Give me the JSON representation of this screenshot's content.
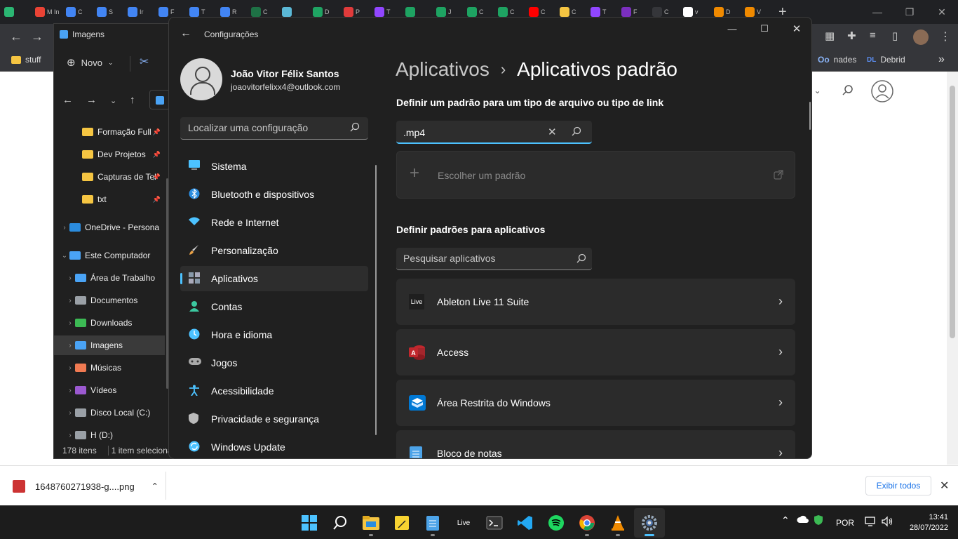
{
  "browser": {
    "tabs": [
      {
        "text": "",
        "color": "#2bb673"
      },
      {
        "text": "M In",
        "color": "#ea4335"
      },
      {
        "text": "C",
        "color": "#4285f4"
      },
      {
        "text": "S",
        "color": "#4285f4"
      },
      {
        "text": "Ir",
        "color": "#4285f4"
      },
      {
        "text": "F",
        "color": "#4285f4"
      },
      {
        "text": "T",
        "color": "#4285f4"
      },
      {
        "text": "R",
        "color": "#4285f4"
      },
      {
        "text": "C",
        "color": "#1e7145"
      },
      {
        "text": "",
        "color": "#5bb8d6"
      },
      {
        "text": "D",
        "color": "#1fa463"
      },
      {
        "text": "P",
        "color": "#e03b3b"
      },
      {
        "text": "T",
        "color": "#9146ff"
      },
      {
        "text": "",
        "color": "#1ea362"
      },
      {
        "text": "J",
        "color": "#1ea362"
      },
      {
        "text": "C",
        "color": "#1ea362"
      },
      {
        "text": "C",
        "color": "#1ea362"
      },
      {
        "text": "C",
        "color": "#ff0000"
      },
      {
        "text": "C",
        "color": "#f5c542"
      },
      {
        "text": "T",
        "color": "#9146ff"
      },
      {
        "text": "F",
        "color": "#7b2fbf"
      },
      {
        "text": "C",
        "color": "#35363a"
      },
      {
        "text": "v",
        "color": "#ffffff"
      },
      {
        "text": "D",
        "color": "#f08a00"
      },
      {
        "text": "V",
        "color": "#f08a00"
      }
    ],
    "bookmarks": [
      "stuff",
      "nades",
      "Debrid"
    ],
    "download_file": "1648760271938-g....png",
    "show_all": "Exibir todos"
  },
  "explorer": {
    "title": "Imagens",
    "new_label": "Novo",
    "tree": [
      {
        "label": "Formação Full",
        "pinned": true,
        "color": "#f5c542"
      },
      {
        "label": "Dev Projetos",
        "pinned": true,
        "color": "#f5c542"
      },
      {
        "label": "Capturas de Tel",
        "pinned": true,
        "color": "#f5c542"
      },
      {
        "label": "txt",
        "pinned": true,
        "color": "#f5c542"
      },
      {
        "label": "OneDrive - Persona",
        "pinned": false,
        "color": "#2b8cde"
      },
      {
        "label": "Este Computador",
        "pinned": false,
        "color": "#4aa3f5"
      },
      {
        "label": "Área de Trabalho",
        "pinned": false,
        "color": "#4aa3f5"
      },
      {
        "label": "Documentos",
        "pinned": false,
        "color": "#9aa0a6"
      },
      {
        "label": "Downloads",
        "pinned": false,
        "color": "#3cba54"
      },
      {
        "label": "Imagens",
        "pinned": false,
        "color": "#4aa3f5"
      },
      {
        "label": "Músicas",
        "pinned": false,
        "color": "#f07a52"
      },
      {
        "label": "Vídeos",
        "pinned": false,
        "color": "#9b59d0"
      },
      {
        "label": "Disco Local (C:)",
        "pinned": false,
        "color": "#9aa0a6"
      },
      {
        "label": "H (D:)",
        "pinned": false,
        "color": "#9aa0a6"
      }
    ],
    "status_count": "178 itens",
    "status_selected": "1 item seleciona"
  },
  "settings": {
    "app_title": "Configurações",
    "profile": {
      "name": "João Vitor Félix Santos",
      "email": "joaovitorfelixx4@outlook.com"
    },
    "search_placeholder": "Localizar uma configuração",
    "nav": [
      {
        "label": "Sistema",
        "icon": "monitor-icon",
        "color": "#4cc2ff"
      },
      {
        "label": "Bluetooth e dispositivos",
        "icon": "bluetooth-icon",
        "color": "#2a8de0"
      },
      {
        "label": "Rede e Internet",
        "icon": "wifi-icon",
        "color": "#4cc2ff"
      },
      {
        "label": "Personalização",
        "icon": "brush-icon",
        "color": "#e8a046"
      },
      {
        "label": "Aplicativos",
        "icon": "apps-icon",
        "color": "#9ab"
      },
      {
        "label": "Contas",
        "icon": "person-icon",
        "color": "#3cc8a0"
      },
      {
        "label": "Hora e idioma",
        "icon": "clock-globe-icon",
        "color": "#4cc2ff"
      },
      {
        "label": "Jogos",
        "icon": "gamepad-icon",
        "color": "#aaa"
      },
      {
        "label": "Acessibilidade",
        "icon": "accessibility-icon",
        "color": "#4cc2ff"
      },
      {
        "label": "Privacidade e segurança",
        "icon": "shield-icon",
        "color": "#bbb"
      },
      {
        "label": "Windows Update",
        "icon": "update-icon",
        "color": "#4cc2ff"
      }
    ],
    "active_nav": 4,
    "breadcrumb": {
      "parent": "Aplicativos",
      "separator": "›",
      "current": "Aplicativos padrão"
    },
    "section1_title": "Definir um padrão para um tipo de arquivo ou tipo de link",
    "ext_value": ".mp4",
    "choose_default": "Escolher um padrão",
    "section2_title": "Definir padrões para aplicativos",
    "app_search_placeholder": "Pesquisar aplicativos",
    "apps": [
      {
        "name": "Ableton Live 11 Suite",
        "icon": "live-icon"
      },
      {
        "name": "Access",
        "icon": "access-icon"
      },
      {
        "name": "Área Restrita do Windows",
        "icon": "sandbox-icon"
      },
      {
        "name": "Bloco de notas",
        "icon": "notepad-icon"
      }
    ]
  },
  "taskbar": {
    "lang": "POR",
    "time": "13:41",
    "date": "28/07/2022"
  }
}
